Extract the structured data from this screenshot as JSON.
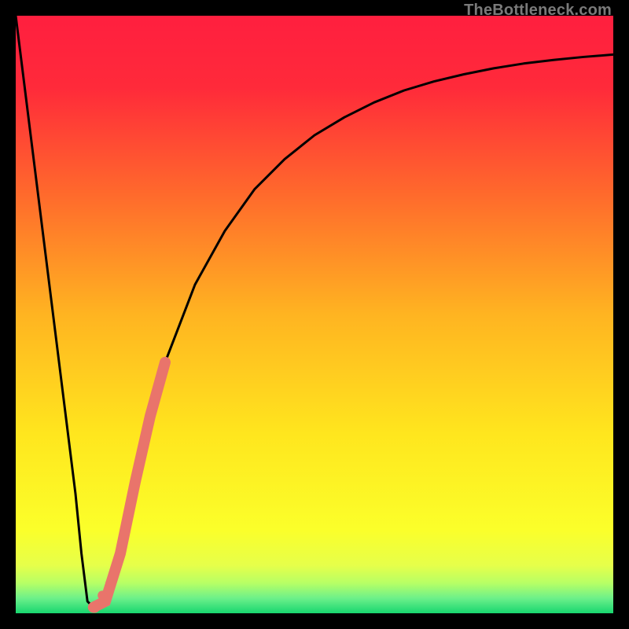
{
  "watermark": "TheBottleneck.com",
  "chart_data": {
    "type": "line",
    "title": "",
    "xlabel": "",
    "ylabel": "",
    "xlim": [
      0,
      100
    ],
    "ylim": [
      0,
      100
    ],
    "x": [
      0,
      2.5,
      5,
      7.5,
      10,
      11,
      12,
      13,
      15,
      17.5,
      20,
      22.5,
      25,
      30,
      35,
      40,
      45,
      50,
      55,
      60,
      65,
      70,
      75,
      80,
      85,
      90,
      95,
      100
    ],
    "y": [
      100,
      80,
      60,
      40,
      20,
      10,
      2,
      1,
      2,
      10,
      22,
      33,
      42,
      55,
      64,
      71,
      76,
      80,
      83,
      85.5,
      87.5,
      89,
      90.2,
      91.2,
      92,
      92.6,
      93.1,
      93.5
    ],
    "highlight_segment": {
      "note": "thicker salmon overlay along part of the rising branch",
      "x": [
        13,
        15,
        17.5,
        20,
        22.5,
        25
      ],
      "y": [
        1,
        2,
        10,
        22,
        33,
        42
      ]
    },
    "gradient_stops": [
      {
        "pos": 0.0,
        "color": "#ff1f3f"
      },
      {
        "pos": 0.12,
        "color": "#ff2a3a"
      },
      {
        "pos": 0.3,
        "color": "#ff6a2c"
      },
      {
        "pos": 0.5,
        "color": "#ffb421"
      },
      {
        "pos": 0.7,
        "color": "#ffe61e"
      },
      {
        "pos": 0.86,
        "color": "#fbff2a"
      },
      {
        "pos": 0.92,
        "color": "#e6ff4a"
      },
      {
        "pos": 0.95,
        "color": "#b6ff66"
      },
      {
        "pos": 0.975,
        "color": "#6cf08a"
      },
      {
        "pos": 1.0,
        "color": "#18d66f"
      }
    ],
    "curve_color": "#000000",
    "highlight_color": "#e9746b"
  }
}
